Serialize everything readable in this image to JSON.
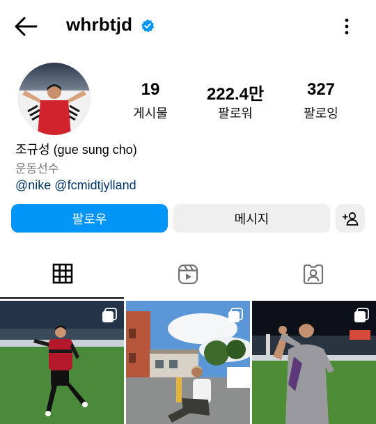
{
  "header": {
    "username": "whrbtjd"
  },
  "stats": [
    {
      "value": "19",
      "label": "게시물"
    },
    {
      "value": "222.4만",
      "label": "팔로워"
    },
    {
      "value": "327",
      "label": "팔로잉"
    }
  ],
  "profile": {
    "name": "조규성 (gue sung cho)",
    "category": "운동선수",
    "mentions": [
      "@nike",
      "@fcmidtjylland"
    ]
  },
  "actions": {
    "follow_label": "팔로우",
    "message_label": "메시지"
  },
  "tabs": [
    {
      "icon": "grid-icon",
      "active": true
    },
    {
      "icon": "reels-icon",
      "active": false
    },
    {
      "icon": "tagged-icon",
      "active": false
    }
  ],
  "colors": {
    "accent": "#0095f6",
    "verified": "#0095f6",
    "link": "#00376b",
    "secondary": "#737373"
  }
}
